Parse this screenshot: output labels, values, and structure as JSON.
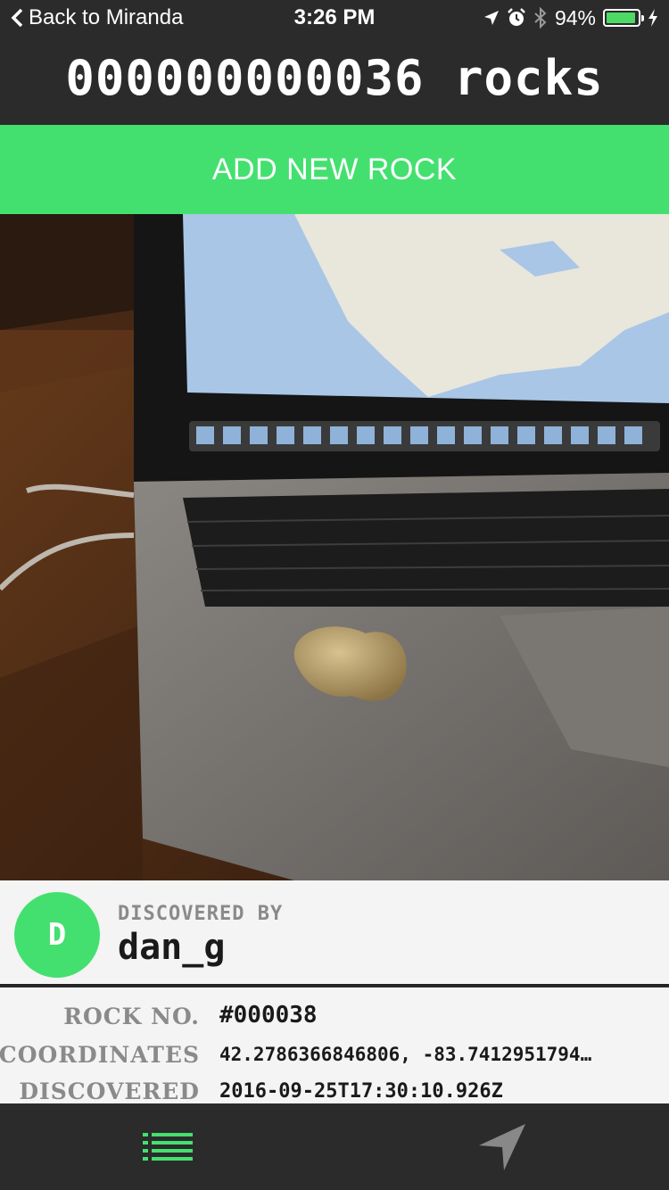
{
  "status_bar": {
    "back_label": "Back to Miranda",
    "time": "3:26 PM",
    "battery_text": "94%",
    "battery_level": 0.94
  },
  "header": {
    "title": "000000000036 rocks"
  },
  "actions": {
    "add_rock_label": "ADD NEW ROCK"
  },
  "discoverer": {
    "label": "DISCOVERED BY",
    "avatar_letter": "D",
    "name": "dan_g"
  },
  "details": [
    {
      "key": "ROCK NO.",
      "value": "#000038"
    },
    {
      "key": "COORDINATES",
      "value": "42.2786366846806, -83.7412951794…"
    },
    {
      "key": "DISCOVERED",
      "value": "2016-09-25T17:30:10.926Z"
    }
  ],
  "tabs": [
    {
      "name": "list-icon",
      "active": true
    },
    {
      "name": "navigation-arrow-icon",
      "active": false
    }
  ],
  "colors": {
    "accent": "#44e06f",
    "bar_background": "#2b2b2b",
    "panel_background": "#f4f4f4",
    "label_gray": "#8a8a8a"
  }
}
